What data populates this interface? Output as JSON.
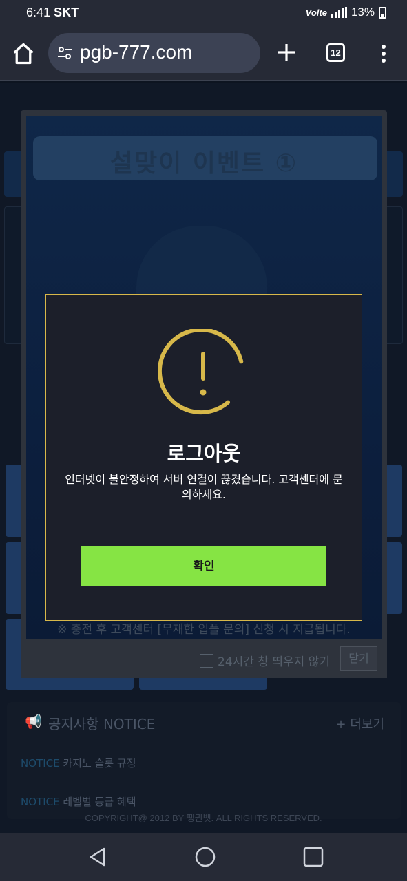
{
  "status_bar": {
    "time": "6:41",
    "carrier": "SKT",
    "network": "Volte",
    "battery_percent": "13%",
    "battery_level": 0.13
  },
  "browser": {
    "url": "pgb-777.com",
    "tab_count": "12",
    "icons": {
      "home": "home-icon",
      "site_settings": "tune-icon",
      "new_tab": "plus-icon",
      "menu": "more-vert-icon"
    }
  },
  "event_popup": {
    "title": "설맞이 이벤트 ①",
    "footnote": "※ 충전 후 고객센터 [무재한 입플 문의] 신청 시 지급됩니다.",
    "dont_show_label": "24시간 창 띄우지 않기",
    "close_label": "닫기"
  },
  "alert": {
    "title": "로그아웃",
    "message": "인터넷이 불안정하여 서버 연결이 끊겼습니다. 고객센터에 문의하세요.",
    "confirm_label": "확인",
    "accent_color": "#d7b84a",
    "button_color": "#86e444"
  },
  "notice": {
    "title": "공지사항 NOTICE",
    "more_label": "+ 더보기",
    "items": [
      {
        "tag": "NOTICE",
        "text": "카지노 슬롯 규정"
      },
      {
        "tag": "NOTICE",
        "text": "레벨별 등급 혜택"
      }
    ]
  },
  "footer": {
    "copyright": "COPYRIGHT@ 2012 BY 펭귄벳. ALL RIGHTS RESERVED."
  }
}
